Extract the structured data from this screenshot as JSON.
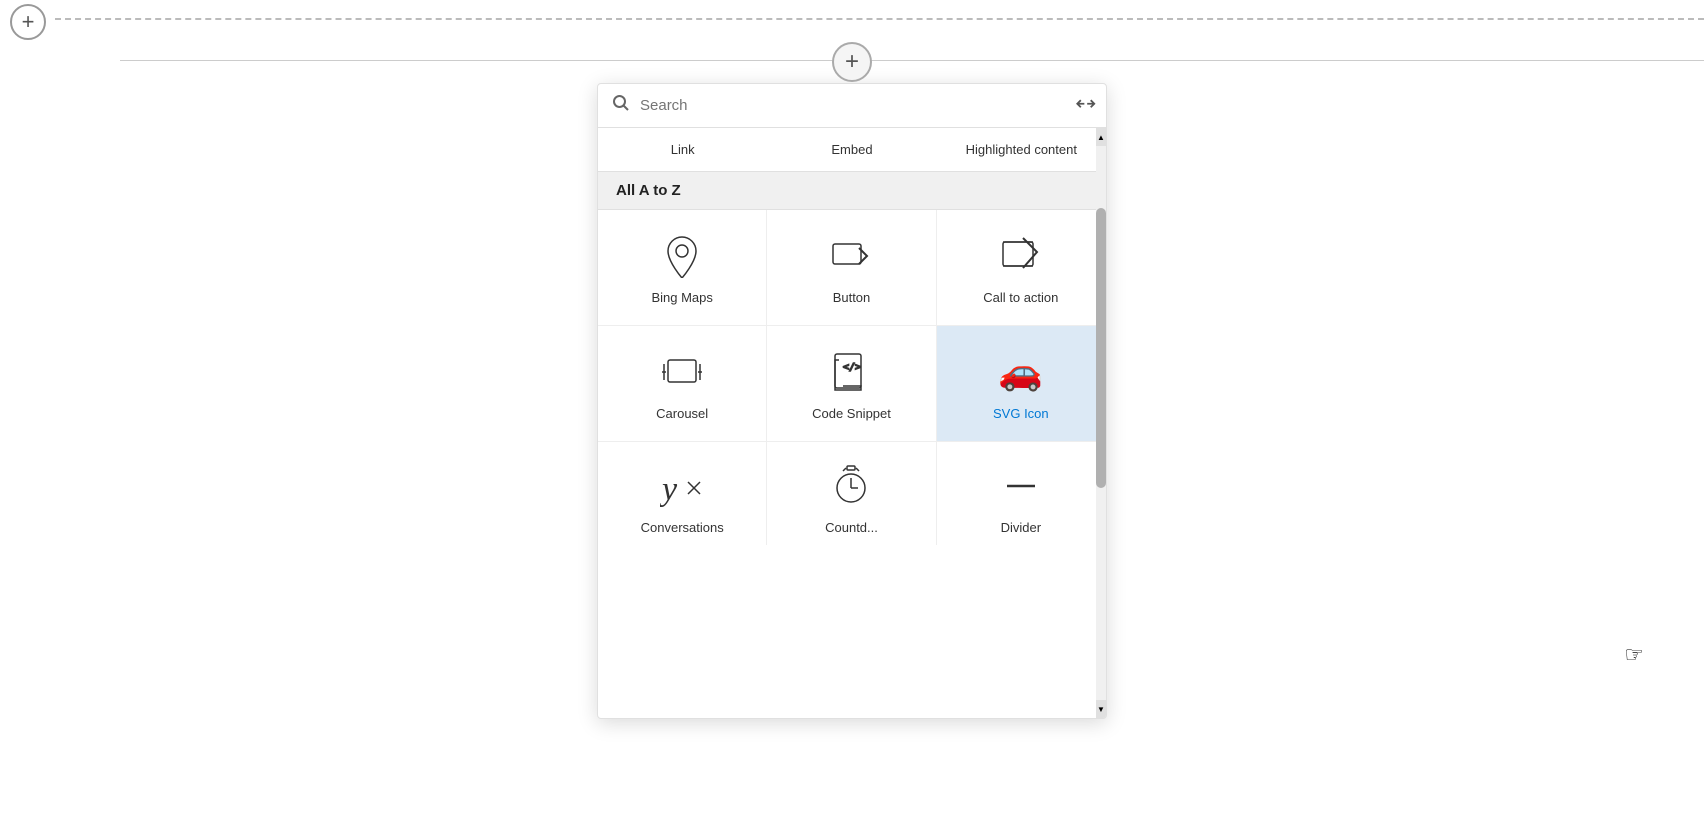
{
  "page": {
    "background": "#ffffff"
  },
  "topLeft": {
    "plus_label": "+"
  },
  "centerPlus": {
    "plus_label": "+"
  },
  "popup": {
    "search": {
      "placeholder": "Search",
      "expand_icon": "⤢"
    },
    "top_categories": [
      {
        "label": "Link"
      },
      {
        "label": "Embed"
      },
      {
        "label": "Highlighted content"
      }
    ],
    "section_header": "All A to Z",
    "grid_items": [
      {
        "id": "bing-maps",
        "label": "Bing Maps",
        "icon_type": "bing-maps",
        "selected": false
      },
      {
        "id": "button",
        "label": "Button",
        "icon_type": "button",
        "selected": false
      },
      {
        "id": "call-to-action",
        "label": "Call to action",
        "icon_type": "call-to-action",
        "selected": false
      },
      {
        "id": "carousel",
        "label": "Carousel",
        "icon_type": "carousel",
        "selected": false
      },
      {
        "id": "code-snippet",
        "label": "Code Snippet",
        "icon_type": "code-snippet",
        "selected": false
      },
      {
        "id": "svg-icon",
        "label": "SVG Icon",
        "icon_type": "svg-icon",
        "selected": true
      }
    ],
    "bottom_items": [
      {
        "id": "conversations",
        "label": "Conversations",
        "icon_type": "yammer"
      },
      {
        "id": "countdown",
        "label": "Countd...",
        "icon_type": "clock"
      },
      {
        "id": "divider",
        "label": "Divider",
        "icon_type": "divider"
      }
    ]
  }
}
